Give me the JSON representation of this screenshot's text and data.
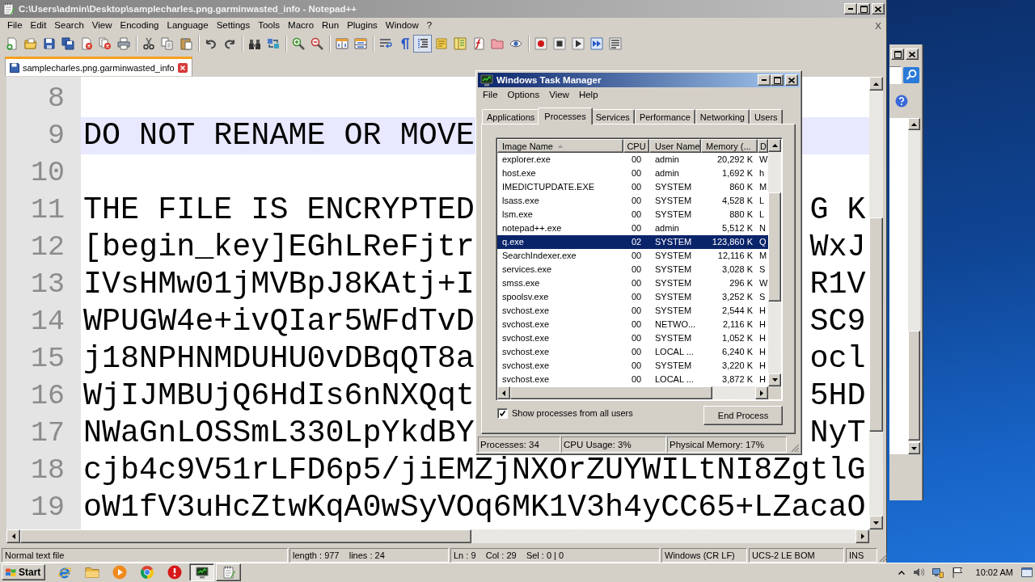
{
  "notepad": {
    "title": "C:\\Users\\admin\\Desktop\\samplecharles.png.garminwasted_info - Notepad++",
    "active": false,
    "menu": [
      "File",
      "Edit",
      "Search",
      "View",
      "Encoding",
      "Language",
      "Settings",
      "Tools",
      "Macro",
      "Run",
      "Plugins",
      "Window",
      "?"
    ],
    "close_document": "X",
    "toolbar": [
      {
        "buttons": [
          {
            "pressed": false
          },
          {
            "pressed": false
          },
          {
            "pressed": false
          },
          {
            "pressed": false
          },
          {
            "pressed": false
          },
          {
            "pressed": false
          },
          {
            "pressed": false
          }
        ]
      },
      {
        "buttons": [
          {
            "pressed": false
          },
          {
            "pressed": false
          },
          {
            "pressed": false
          }
        ]
      },
      {
        "buttons": [
          {
            "pressed": false
          },
          {
            "pressed": false
          }
        ]
      },
      {
        "buttons": [
          {
            "pressed": false
          },
          {
            "pressed": false
          }
        ]
      },
      {
        "buttons": [
          {
            "pressed": false
          },
          {
            "pressed": false
          }
        ]
      },
      {
        "buttons": [
          {
            "pressed": false
          },
          {
            "pressed": false
          }
        ]
      },
      {
        "buttons": [
          {
            "pressed": false
          },
          {
            "pressed": false
          },
          {
            "pressed": true
          },
          {
            "pressed": false
          },
          {
            "pressed": false
          },
          {
            "pressed": false
          },
          {
            "pressed": false
          },
          {
            "pressed": false
          }
        ]
      },
      {
        "buttons": [
          {
            "pressed": false
          },
          {
            "pressed": false
          },
          {
            "pressed": false
          },
          {
            "pressed": false
          },
          {
            "pressed": false
          }
        ]
      }
    ],
    "tabs": [
      {
        "label": "samplecharles.png.garminwasted_info",
        "selected": true
      }
    ],
    "editor": {
      "lines": [
        {
          "number": "8",
          "current": false
        },
        {
          "number": "9",
          "text": "DO NOT RENAME OR MOVE",
          "current": true
        },
        {
          "number": "10",
          "current": false
        },
        {
          "number": "11",
          "text": "THE FILE IS ENCRYPTED",
          "text_right": "G K",
          "current": false
        },
        {
          "number": "12",
          "text": "[begin_key]EGhLReFjtr",
          "text_right": "WxJ",
          "current": false
        },
        {
          "number": "13",
          "text": "IVsHMw01jMVBpJ8KAtj+I",
          "text_right": "R1V",
          "current": false
        },
        {
          "number": "14",
          "text": "WPUGW4e+ivQIar5WFdTvD",
          "text_right": "SC9",
          "current": false
        },
        {
          "number": "15",
          "text": "j18NPHNMDUHU0vDBqQT8a",
          "text_right": "ocl",
          "current": false
        },
        {
          "number": "16",
          "text": "WjIJMBUjQ6HdIs6nNXQqt",
          "text_right": "5HD",
          "current": false
        },
        {
          "number": "17",
          "text": "NWaGnLOSSmL330LpYkdBY",
          "text_right": "NyT",
          "current": false
        },
        {
          "number": "18",
          "text": "cjb4c9V51rLFD6p5/jiEMZjNXOrZUYWILtNI8ZgtlG",
          "current": false
        },
        {
          "number": "19",
          "text": "oW1fV3uHcZtwKqA0wSyVOq6MK1V3h4yCC65+LZacaO",
          "current": false
        }
      ]
    },
    "status_bar": [
      "Normal text file",
      "length : 977    lines : 24",
      "Ln : 9    Col : 29    Sel : 0 | 0",
      "Windows (CR LF)",
      "UCS-2 LE BOM",
      "INS"
    ]
  },
  "task_manager": {
    "title": "Windows Task Manager",
    "active": true,
    "menu": [
      "File",
      "Options",
      "View",
      "Help"
    ],
    "tabs": [
      {
        "label": "Applications",
        "selected": false
      },
      {
        "label": "Processes",
        "selected": true
      },
      {
        "label": "Services",
        "selected": false
      },
      {
        "label": "Performance",
        "selected": false
      },
      {
        "label": "Networking",
        "selected": false
      },
      {
        "label": "Users",
        "selected": false
      }
    ],
    "table": {
      "columns": [
        {
          "label": "Image Name",
          "sorted": true
        },
        {
          "label": "CPU",
          "sorted": false
        },
        {
          "label": "User Name",
          "sorted": false
        },
        {
          "label": "Memory (...",
          "sorted": false
        },
        {
          "label": "D",
          "sorted": false
        }
      ],
      "rows": [
        {
          "image_name": "explorer.exe",
          "cpu": "00",
          "user_name": "admin",
          "memory": "20,292 K",
          "column_5": "W",
          "selected": false
        },
        {
          "image_name": "host.exe",
          "cpu": "00",
          "user_name": "admin",
          "memory": "1,692 K",
          "column_5": "h",
          "selected": false
        },
        {
          "image_name": "IMEDICTUPDATE.EXE",
          "cpu": "00",
          "user_name": "SYSTEM",
          "memory": "860 K",
          "column_5": "M",
          "selected": false
        },
        {
          "image_name": "lsass.exe",
          "cpu": "00",
          "user_name": "SYSTEM",
          "memory": "4,528 K",
          "column_5": "L",
          "selected": false
        },
        {
          "image_name": "lsm.exe",
          "cpu": "00",
          "user_name": "SYSTEM",
          "memory": "880 K",
          "column_5": "L",
          "selected": false
        },
        {
          "image_name": "notepad++.exe",
          "cpu": "00",
          "user_name": "admin",
          "memory": "5,512 K",
          "column_5": "N",
          "selected": false
        },
        {
          "image_name": "q.exe",
          "cpu": "02",
          "user_name": "SYSTEM",
          "memory": "123,860 K",
          "column_5": "Q",
          "selected": true
        },
        {
          "image_name": "SearchIndexer.exe",
          "cpu": "00",
          "user_name": "SYSTEM",
          "memory": "12,116 K",
          "column_5": "M",
          "selected": false
        },
        {
          "image_name": "services.exe",
          "cpu": "00",
          "user_name": "SYSTEM",
          "memory": "3,028 K",
          "column_5": "S",
          "selected": false
        },
        {
          "image_name": "smss.exe",
          "cpu": "00",
          "user_name": "SYSTEM",
          "memory": "296 K",
          "column_5": "W",
          "selected": false
        },
        {
          "image_name": "spoolsv.exe",
          "cpu": "00",
          "user_name": "SYSTEM",
          "memory": "3,252 K",
          "column_5": "S",
          "selected": false
        },
        {
          "image_name": "svchost.exe",
          "cpu": "00",
          "user_name": "SYSTEM",
          "memory": "2,544 K",
          "column_5": "H",
          "selected": false
        },
        {
          "image_name": "svchost.exe",
          "cpu": "00",
          "user_name": "NETWO...",
          "memory": "2,116 K",
          "column_5": "H",
          "selected": false
        },
        {
          "image_name": "svchost.exe",
          "cpu": "00",
          "user_name": "SYSTEM",
          "memory": "1,052 K",
          "column_5": "H",
          "selected": false
        },
        {
          "image_name": "svchost.exe",
          "cpu": "00",
          "user_name": "LOCAL ...",
          "memory": "6,240 K",
          "column_5": "H",
          "selected": false
        },
        {
          "image_name": "svchost.exe",
          "cpu": "00",
          "user_name": "SYSTEM",
          "memory": "3,220 K",
          "column_5": "H",
          "selected": false
        },
        {
          "image_name": "svchost.exe",
          "cpu": "00",
          "user_name": "LOCAL ...",
          "memory": "3,872 K",
          "column_5": "H",
          "selected": false
        }
      ]
    },
    "show_all_users": {
      "label": "Show processes from all users",
      "checked": true
    },
    "end_process": "End Process",
    "status_bar": [
      "Processes: 34",
      "CPU Usage: 3%",
      "Physical Memory: 17%"
    ]
  },
  "taskbar": {
    "start": "Start",
    "tasks": [
      {
        "selected": true
      },
      {
        "selected": false
      }
    ],
    "clock": "10:02 AM"
  }
}
